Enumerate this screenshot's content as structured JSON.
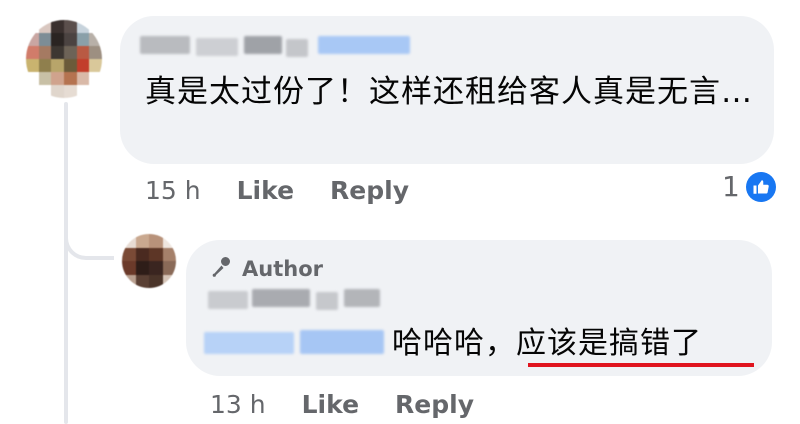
{
  "comment": {
    "author_name": "",
    "text": "真是太过份了！这样还租给客人真是无言…",
    "time": "15 h",
    "like_label": "Like",
    "reply_label": "Reply",
    "reaction_count": "1",
    "reaction_icon": "thumbs-up-icon",
    "accent_color": "#1877f2"
  },
  "reply": {
    "badge_icon": "microphone-icon",
    "badge_label": "Author",
    "text": "哈哈哈，",
    "highlight_text": "应该是搞错了",
    "time": "13 h",
    "like_label": "Like",
    "reply_label": "Reply",
    "underline_color": "#e0141e"
  }
}
